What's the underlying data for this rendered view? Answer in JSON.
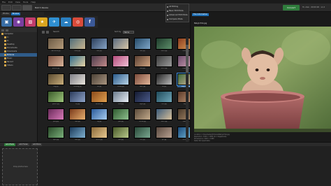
{
  "menubar": [
    "File",
    "Edit",
    "View",
    "Tools",
    "Help"
  ],
  "toolbar": {
    "title": "Batch Resize",
    "go_label": "Convert",
    "user_text": "Hi, Alex  ·  00:00:00  ·  v1.0"
  },
  "options_menu": {
    "items": [
      {
        "label": "All Editing",
        "checked": false
      },
      {
        "label": "Basic Edit Mode",
        "checked": true
      },
      {
        "label": "Advanced Edit Mode",
        "checked": false
      },
      {
        "label": "Compare Mode",
        "checked": false
      }
    ]
  },
  "left_tabs": [
    {
      "label": "Photos",
      "active": false
    },
    {
      "label": "Browse",
      "active": true
    }
  ],
  "editors": [
    {
      "icon": "photo-editor-icon",
      "color": "#3a6ea5",
      "glyph": "▣"
    },
    {
      "icon": "color-wheel-icon",
      "color": "#7a3fa0",
      "glyph": "◉"
    },
    {
      "icon": "rainbow-icon",
      "color": "#c23b6b",
      "glyph": "▨"
    },
    {
      "icon": "star-icon",
      "color": "#d9a520",
      "glyph": "★"
    },
    {
      "icon": "bird-icon",
      "color": "#2f8fd1",
      "glyph": "✈"
    },
    {
      "icon": "cloud-icon",
      "color": "#2a7fc0",
      "glyph": "☁"
    },
    {
      "icon": "wheel-icon",
      "color": "#d94b3a",
      "glyph": "◎"
    },
    {
      "icon": "facebook-icon",
      "color": "#3b5998",
      "glyph": "f"
    }
  ],
  "tree": [
    {
      "label": "Computer",
      "indent": 0,
      "sel": false
    },
    {
      "label": "C:",
      "indent": 1,
      "sel": false
    },
    {
      "label": "D:",
      "indent": 1,
      "sel": false
    },
    {
      "label": "Desktop",
      "indent": 1,
      "sel": false
    },
    {
      "label": "Documents",
      "indent": 1,
      "sel": false
    },
    {
      "label": "Downloads",
      "indent": 1,
      "sel": false
    },
    {
      "label": "Pictures",
      "indent": 1,
      "sel": true
    },
    {
      "label": "Music",
      "indent": 1,
      "sel": false
    },
    {
      "label": "Recent",
      "indent": 1,
      "sel": false
    },
    {
      "label": "Videos",
      "indent": 1,
      "sel": false
    }
  ],
  "browser": {
    "search": "Search",
    "sort_label": "Sort by",
    "sort_value": "Name"
  },
  "thumbnails": [
    {
      "cap": "#Beautiful.jpg",
      "c1": "#6b5a45",
      "c2": "#b49a7a"
    },
    {
      "cap": "family.jpg",
      "c1": "#4f6d7a",
      "c2": "#c9b58f"
    },
    {
      "cap": "kids.jpg",
      "c1": "#2b3d5a",
      "c2": "#86a3c4"
    },
    {
      "cap": "mountain.jpg",
      "c1": "#5a6a7e",
      "c2": "#d7c6a8"
    },
    {
      "cap": "lake.jpg",
      "c1": "#254a68",
      "c2": "#7fa7c8"
    },
    {
      "cap": "forest.jpg",
      "c1": "#1e3b2b",
      "c2": "#5e8f6b"
    },
    {
      "cap": "sunset.jpg",
      "c1": "#8a3b1f",
      "c2": "#e0a55a"
    },
    {
      "cap": "portrait.jpg",
      "c1": "#7a5040",
      "c2": "#d8b399"
    },
    {
      "cap": "beach.jpg",
      "c1": "#2f6a8a",
      "c2": "#e6d3a5"
    },
    {
      "cap": "girl.jpg",
      "c1": "#4a3a4a",
      "c2": "#c28a8a"
    },
    {
      "cap": "flowers.jpg",
      "c1": "#b34b7a",
      "c2": "#f2c1d6"
    },
    {
      "cap": "baby.jpg",
      "c1": "#5a4032",
      "c2": "#cfa27f"
    },
    {
      "cap": "street.jpg",
      "c1": "#3c3c3c",
      "c2": "#9a9a9a"
    },
    {
      "cap": "couple.jpg",
      "c1": "#6a4b6a",
      "c2": "#d7a6b8"
    },
    {
      "cap": "dog.jpg",
      "c1": "#5a4a30",
      "c2": "#c8ad7a"
    },
    {
      "cap": "wedding.jpg",
      "c1": "#7d7d85",
      "c2": "#e8e4dc"
    },
    {
      "cap": "cat.jpg",
      "c1": "#4a4035",
      "c2": "#a99580"
    },
    {
      "cap": "holiday.jpg",
      "c1": "#2a5a8a",
      "c2": "#b8d3e6"
    },
    {
      "cap": "smile.jpg",
      "c1": "#7a4a3a",
      "c2": "#e2b598"
    },
    {
      "cap": "bw.jpg",
      "c1": "#222222",
      "c2": "#bbbbbb"
    },
    {
      "cap": "BabyInTub.jpg",
      "c1": "#3d6a3a",
      "c2": "#d9b9a0",
      "sel": true
    },
    {
      "cap": "garden.jpg",
      "c1": "#3a5a2a",
      "c2": "#9cc47a"
    },
    {
      "cap": "city.jpg",
      "c1": "#2a3a5a",
      "c2": "#8fa3c8"
    },
    {
      "cap": "autumn.jpg",
      "c1": "#8a4a1a",
      "c2": "#e0a050"
    },
    {
      "cap": "snow.jpg",
      "c1": "#6a7a8a",
      "c2": "#e8eef5"
    },
    {
      "cap": "night.jpg",
      "c1": "#141a30",
      "c2": "#4a5a8a"
    },
    {
      "cap": "river.jpg",
      "c1": "#1f4a5a",
      "c2": "#6fa6b8"
    },
    {
      "cap": "boy.jpg",
      "c1": "#5a3a2a",
      "c2": "#c79a78"
    },
    {
      "cap": "party.jpg",
      "c1": "#6a2a5a",
      "c2": "#d87ab8"
    },
    {
      "cap": "food.jpg",
      "c1": "#7a3a1a",
      "c2": "#e8b070"
    },
    {
      "cap": "sky.jpg",
      "c1": "#2a5a9a",
      "c2": "#a8cdf0"
    },
    {
      "cap": "park.jpg",
      "c1": "#2f5a2f",
      "c2": "#8fc08f"
    },
    {
      "cap": "friends.jpg",
      "c1": "#5a4a3a",
      "c2": "#c4ab8c"
    },
    {
      "cap": "travel.jpg",
      "c1": "#3a5a7a",
      "c2": "#d8c09a"
    },
    {
      "cap": "home.jpg",
      "c1": "#4a3a2a",
      "c2": "#b09070"
    },
    {
      "cap": "sport.jpg",
      "c1": "#2a4a2a",
      "c2": "#7ab07a"
    },
    {
      "cap": "boat.jpg",
      "c1": "#1a3a5a",
      "c2": "#7fb0d0"
    },
    {
      "cap": "desert.jpg",
      "c1": "#8a6a3a",
      "c2": "#e8c890"
    },
    {
      "cap": "farm.jpg",
      "c1": "#4a5a2a",
      "c2": "#b8c88a"
    },
    {
      "cap": "tree.jpg",
      "c1": "#2a4a3a",
      "c2": "#7aa890"
    },
    {
      "cap": "pet.jpg",
      "c1": "#5a4a40",
      "c2": "#b8a090"
    },
    {
      "cap": "ocean.jpg",
      "c1": "#1a4a7a",
      "c2": "#7ac0e0"
    }
  ],
  "preview": {
    "tab": "File Information",
    "filename": "BabyInTub.jpg",
    "info": [
      "Location: C:\\Users\\Alex\\Pictures\\BabyInTub.jpg",
      "Resolution: 1920 × 1080 (2.1 megapixels)",
      "Dimensions: 1920 × 1080",
      "Date: Not Applicable",
      "Metadata Fields"
    ]
  },
  "bottom": {
    "add_photo": "Add Photo",
    "add_folder": "Add Folder",
    "add_more": "Add More",
    "dropzone": "Drop photos here"
  }
}
